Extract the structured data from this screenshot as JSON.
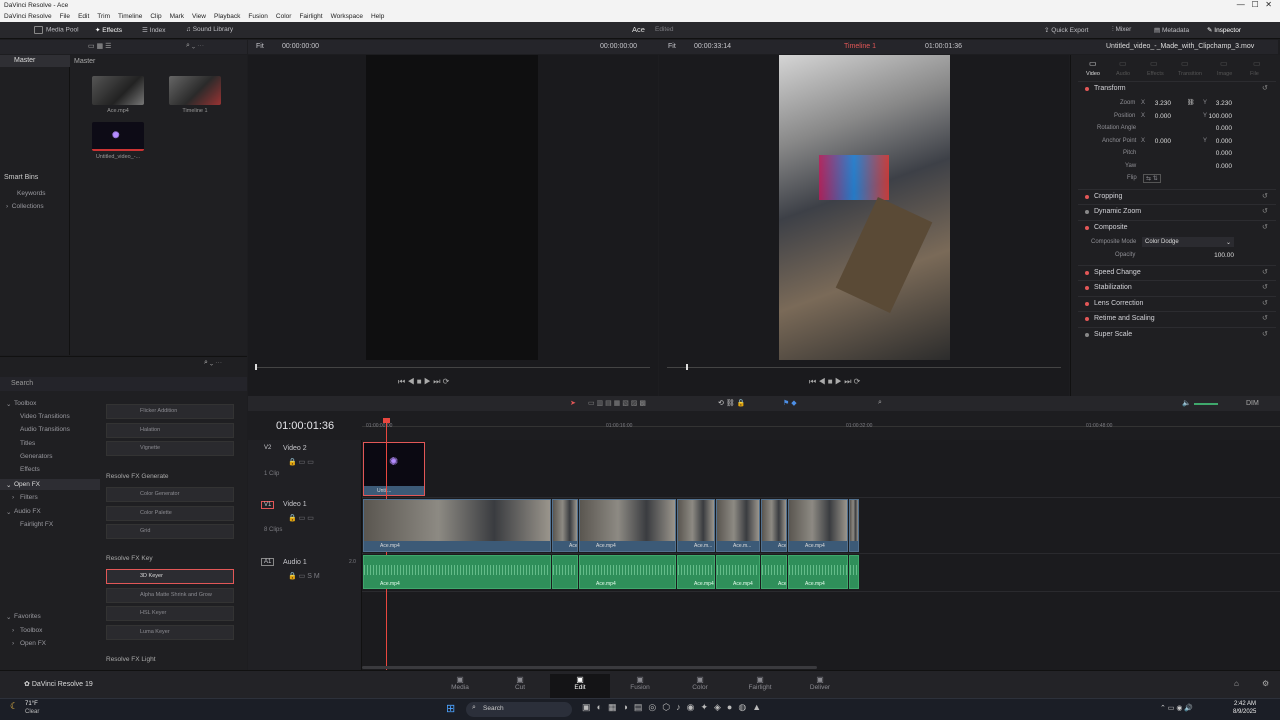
{
  "window": {
    "title": "DaVinci Resolve - Ace"
  },
  "menu": [
    "DaVinci Resolve",
    "File",
    "Edit",
    "Trim",
    "Timeline",
    "Clip",
    "Mark",
    "View",
    "Playback",
    "Fusion",
    "Color",
    "Fairlight",
    "Workspace",
    "Help"
  ],
  "toolbar": {
    "media_pool": "Media Pool",
    "effects": "Effects",
    "index": "Index",
    "sound_library": "Sound Library",
    "project_name": "Ace",
    "project_status": "Edited",
    "quick_export": "Quick Export",
    "mixer": "Mixer",
    "metadata": "Metadata",
    "inspector": "Inspector"
  },
  "viewer_bar": {
    "src_fit": "Fit",
    "src_tc": "00:00:00:00",
    "src_tc2": "00:00:00:00",
    "prg_fit": "Fit",
    "prg_duration": "00:00:33:14",
    "timeline_name": "Timeline 1",
    "prg_tc": "01:00:01:36",
    "clip_name": "Untitled_video_-_Made_with_Clipchamp_3.mov"
  },
  "media_pool": {
    "bin": "Master",
    "bin_header": "Master",
    "clips": [
      "Ace.mp4",
      "Timeline 1",
      "Untitled_video_-..."
    ],
    "smart_bins": "Smart Bins",
    "smart_items": [
      "Keywords",
      "Collections"
    ]
  },
  "effects": {
    "search_placeholder": "Search",
    "toolbox": "Toolbox",
    "toolbox_items": [
      "Video Transitions",
      "Audio Transitions",
      "Titles",
      "Generators",
      "Effects"
    ],
    "open_fx": "Open FX",
    "open_fx_items": [
      "Filters"
    ],
    "audio_fx": "Audio FX",
    "audio_fx_items": [
      "Fairlight FX"
    ],
    "favorites": "Favorites",
    "favorites_items": [
      "Toolbox",
      "Open FX"
    ],
    "list_top": [
      "Flicker Addition",
      "Halation",
      "Vignette"
    ],
    "group_generate": "Resolve FX Generate",
    "generate_items": [
      "Color Generator",
      "Color Palette",
      "Grid"
    ],
    "group_key": "Resolve FX Key",
    "key_items": [
      "3D Keyer",
      "Alpha Matte Shrink and Grow",
      "HSL Keyer",
      "Luma Keyer"
    ],
    "group_light": "Resolve FX Light"
  },
  "timeline": {
    "timecode": "01:00:01:36",
    "ruler": [
      "01:00:00:00",
      "01:00:16:00",
      "01:00:32:00",
      "01:00:48:00"
    ],
    "zoom_label": "DIM",
    "tracks": {
      "v2": {
        "id": "V2",
        "name": "Video 2",
        "clips": "1 Clip",
        "clip_label": "Untit..."
      },
      "v1": {
        "id": "V1",
        "name": "Video 1",
        "clips": "8 Clips",
        "clip_label": "Ace.mp4",
        "clip_short": "Ace.m..."
      },
      "a1": {
        "id": "A1",
        "name": "Audio 1",
        "level": "2.0",
        "clip_label": "Ace.mp4",
        "clip_short": "Ace.mp4"
      }
    }
  },
  "inspector": {
    "tabs": [
      "Video",
      "Audio",
      "Effects",
      "Transition",
      "Image",
      "File"
    ],
    "sections": [
      "Transform",
      "Cropping",
      "Dynamic Zoom",
      "Composite",
      "Speed Change",
      "Stabilization",
      "Lens Correction",
      "Retime and Scaling",
      "Super Scale"
    ],
    "transform": {
      "zoom_label": "Zoom",
      "zoom_x": "3.230",
      "zoom_y": "3.230",
      "position_label": "Position",
      "pos_x": "0.000",
      "pos_y": "100.000",
      "rotation_label": "Rotation Angle",
      "rotation": "0.000",
      "anchor_label": "Anchor Point",
      "anchor_x": "0.000",
      "anchor_y": "0.000",
      "pitch_label": "Pitch",
      "pitch": "0.000",
      "yaw_label": "Yaw",
      "yaw": "0.000",
      "flip_label": "Flip"
    },
    "composite": {
      "mode_label": "Composite Mode",
      "mode": "Color Dodge",
      "opacity_label": "Opacity",
      "opacity": "100.00"
    }
  },
  "pages": [
    "Media",
    "Cut",
    "Edit",
    "Fusion",
    "Color",
    "Fairlight",
    "Deliver"
  ],
  "app_brand": "DaVinci Resolve 19",
  "taskbar": {
    "weather_temp": "71°F",
    "weather_desc": "Clear",
    "search": "Search",
    "time": "2:42 AM",
    "date": "8/9/2025"
  },
  "colors": {
    "accent_red": "#e25757",
    "video_clip": "#3c5a77",
    "audio_clip": "#2f8f5a",
    "playhead": "#e8473f"
  }
}
